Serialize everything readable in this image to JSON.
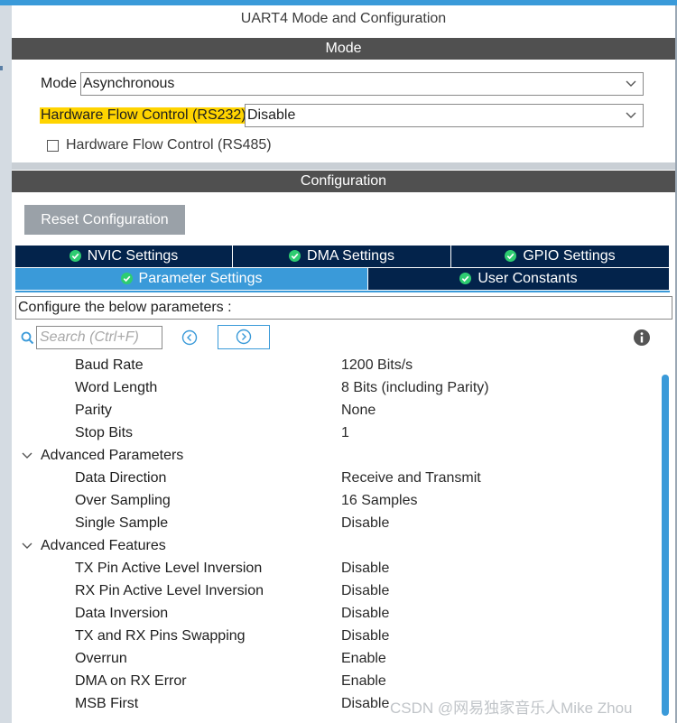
{
  "window": {
    "title": "UART4 Mode and Configuration"
  },
  "mode_section": {
    "header": "Mode",
    "mode": {
      "label": "Mode",
      "value": "Asynchronous"
    },
    "rs232": {
      "label": "Hardware Flow Control (RS232)",
      "value": "Disable"
    },
    "rs485": {
      "label": "Hardware Flow Control (RS485)",
      "checked": false
    }
  },
  "config_section": {
    "header": "Configuration",
    "reset_label": "Reset Configuration",
    "tabs_row1": [
      {
        "label": "NVIC Settings"
      },
      {
        "label": "DMA Settings"
      },
      {
        "label": "GPIO Settings"
      }
    ],
    "tabs_row2": [
      {
        "label": "Parameter Settings",
        "active": true
      },
      {
        "label": "User Constants"
      }
    ],
    "describe": "Configure the below parameters :",
    "search_placeholder": "Search (Ctrl+F)"
  },
  "params": {
    "basic": [
      {
        "name": "Baud Rate",
        "value": "1200 Bits/s"
      },
      {
        "name": "Word Length",
        "value": "8 Bits (including Parity)"
      },
      {
        "name": "Parity",
        "value": "None"
      },
      {
        "name": "Stop Bits",
        "value": "1"
      }
    ],
    "advanced_parameters": {
      "label": "Advanced Parameters",
      "items": [
        {
          "name": "Data Direction",
          "value": "Receive and Transmit"
        },
        {
          "name": "Over Sampling",
          "value": "16 Samples"
        },
        {
          "name": "Single Sample",
          "value": "Disable"
        }
      ]
    },
    "advanced_features": {
      "label": "Advanced Features",
      "items": [
        {
          "name": "TX Pin Active Level Inversion",
          "value": "Disable"
        },
        {
          "name": "RX Pin Active Level Inversion",
          "value": "Disable"
        },
        {
          "name": "Data Inversion",
          "value": "Disable"
        },
        {
          "name": "TX and RX Pins Swapping",
          "value": "Disable"
        },
        {
          "name": "Overrun",
          "value": "Enable"
        },
        {
          "name": "DMA on RX Error",
          "value": "Enable"
        },
        {
          "name": "MSB First",
          "value": "Disable"
        }
      ]
    }
  },
  "watermark": "CSDN @网易独家音乐人Mike Zhou",
  "colors": {
    "accent": "#3a9ad9",
    "tab_dark": "#03234b",
    "section_header": "#505050",
    "highlight": "#ffd400",
    "check": "#2ecc71"
  }
}
